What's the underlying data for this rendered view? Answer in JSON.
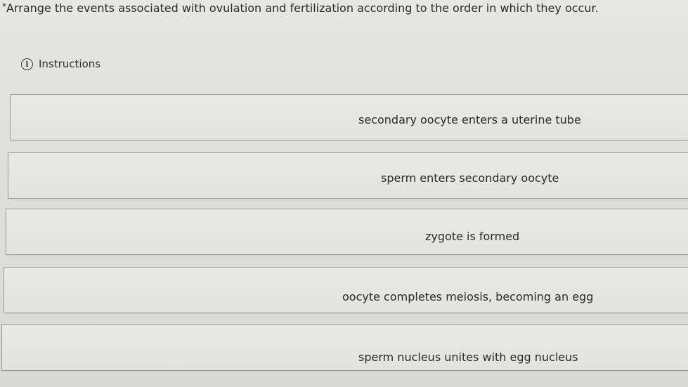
{
  "question": {
    "text": "Arrange the events associated with ovulation and fertilization according to the order in which they occur."
  },
  "instructions": {
    "label": "Instructions"
  },
  "items": [
    {
      "label": "secondary oocyte enters a uterine tube"
    },
    {
      "label": "sperm enters secondary oocyte"
    },
    {
      "label": "zygote is formed"
    },
    {
      "label": "oocyte completes meiosis, becoming an egg"
    },
    {
      "label": "sperm nucleus unites with egg nucleus"
    }
  ]
}
